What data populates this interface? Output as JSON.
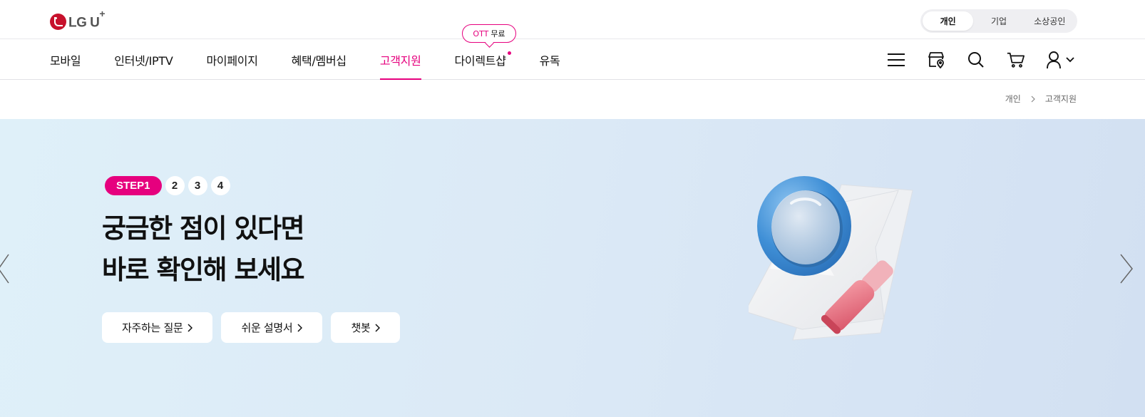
{
  "logo": {
    "text": "LG U",
    "plus": "+"
  },
  "segment": {
    "items": [
      {
        "label": "개인",
        "active": true
      },
      {
        "label": "기업",
        "active": false
      },
      {
        "label": "소상공인",
        "active": false
      }
    ]
  },
  "nav": {
    "items": [
      {
        "label": "모바일"
      },
      {
        "label": "인터넷/IPTV"
      },
      {
        "label": "마이페이지"
      },
      {
        "label": "혜택/멤버십"
      },
      {
        "label": "고객지원",
        "active": true
      },
      {
        "label": "다이렉트샵",
        "dot": true
      },
      {
        "label": "유독"
      }
    ],
    "ott_bubble": {
      "tag": "OTT",
      "text": "무료"
    }
  },
  "header_icons": [
    "menu-icon",
    "store-location-icon",
    "search-icon",
    "cart-icon",
    "user-icon"
  ],
  "breadcrumb": {
    "items": [
      "개인",
      "고객지원"
    ]
  },
  "hero": {
    "step_active": "STEP1",
    "steps": [
      "2",
      "3",
      "4"
    ],
    "title_line1": "궁금한 점이 있다면",
    "title_line2": "바로 확인해 보세요",
    "buttons": [
      "자주하는 질문",
      "쉬운 설명서",
      "챗봇"
    ]
  },
  "colors": {
    "accent": "#e6007e",
    "brand_red": "#c7112c",
    "hero_bg": "#dceaf6",
    "magnifier_blue": "#3f8fd6",
    "handle_pink": "#e8707e"
  }
}
